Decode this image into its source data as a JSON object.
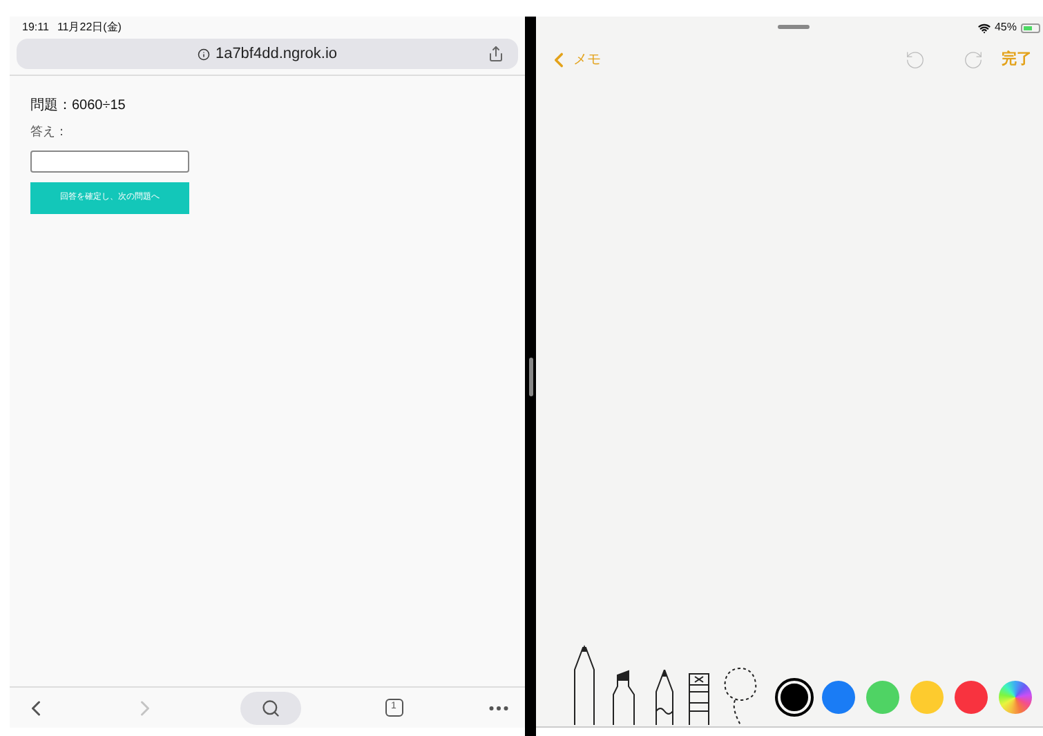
{
  "status_bar": {
    "time": "19:11",
    "date": "11月22日(金)",
    "battery": "45%"
  },
  "browser": {
    "url": "1a7bf4dd.ngrok.io",
    "question": "問題：6060÷15",
    "answer_label": "答え：",
    "submit": "回答を確定し、次の問題へ",
    "tabs_count": "1",
    "forward_disabled": true
  },
  "notes": {
    "back": "メモ",
    "done": "完了",
    "tools": [
      {
        "kind": "pen"
      },
      {
        "kind": "marker"
      },
      {
        "kind": "pencil"
      },
      {
        "kind": "eraser"
      },
      {
        "kind": "lasso"
      }
    ],
    "colors": [
      {
        "color": "#000000",
        "selected": true
      },
      {
        "color": "#1a7cf5",
        "selected": false
      },
      {
        "color": "#4fd364",
        "selected": false
      },
      {
        "color": "#fdcb2e",
        "selected": false
      },
      {
        "color": "#f8333f",
        "selected": false
      }
    ]
  }
}
